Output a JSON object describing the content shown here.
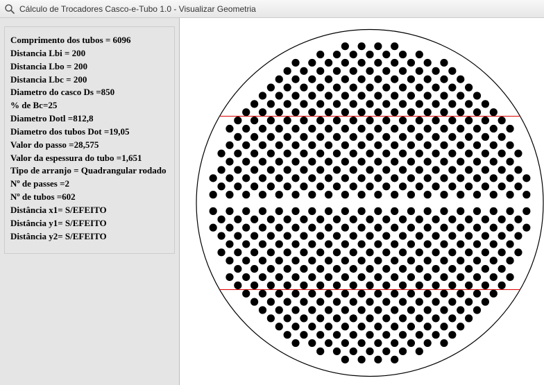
{
  "window": {
    "title": "Cálculo de Trocadores Casco-e-Tubo 1.0 - Visualizar Geometria"
  },
  "params": {
    "comprimento_tubos": "Comprimento dos tubos =  6096",
    "distancia_lbi": "Distancia Lbi =  200",
    "distancia_lbo": "Distancia Lbo = 200",
    "distancia_lbc": "Distancia Lbc = 200",
    "diametro_casco": "Diametro do casco Ds =850",
    "percent_bc": "% de Bc=25",
    "diametro_dotl": "Diametro Dotl =812,8",
    "diametro_tubos": "Diametro dos tubos Dot =19,05",
    "valor_passo": "Valor do passo =28,575",
    "valor_espessura": "Valor da espessura do tubo =1,651",
    "tipo_arranjo": "Tipo de arranjo = Quadrangular rodado",
    "n_passes": "Nº de passes =2",
    "n_tubos": "Nº de tubos =602",
    "dist_x1": "Distância x1=  S/EFEITO",
    "dist_y1": "Distância y1=  S/EFEITO",
    "dist_y2": "Distância y2=  S/EFEITO"
  },
  "geometry": {
    "shell_diameter": 850,
    "otl_diameter": 812.8,
    "tube_diameter": 19.05,
    "pitch": 28.575,
    "bc_percent": 25,
    "n_tubes": 602,
    "n_passes": 2,
    "arrangement": "rotated-square"
  }
}
